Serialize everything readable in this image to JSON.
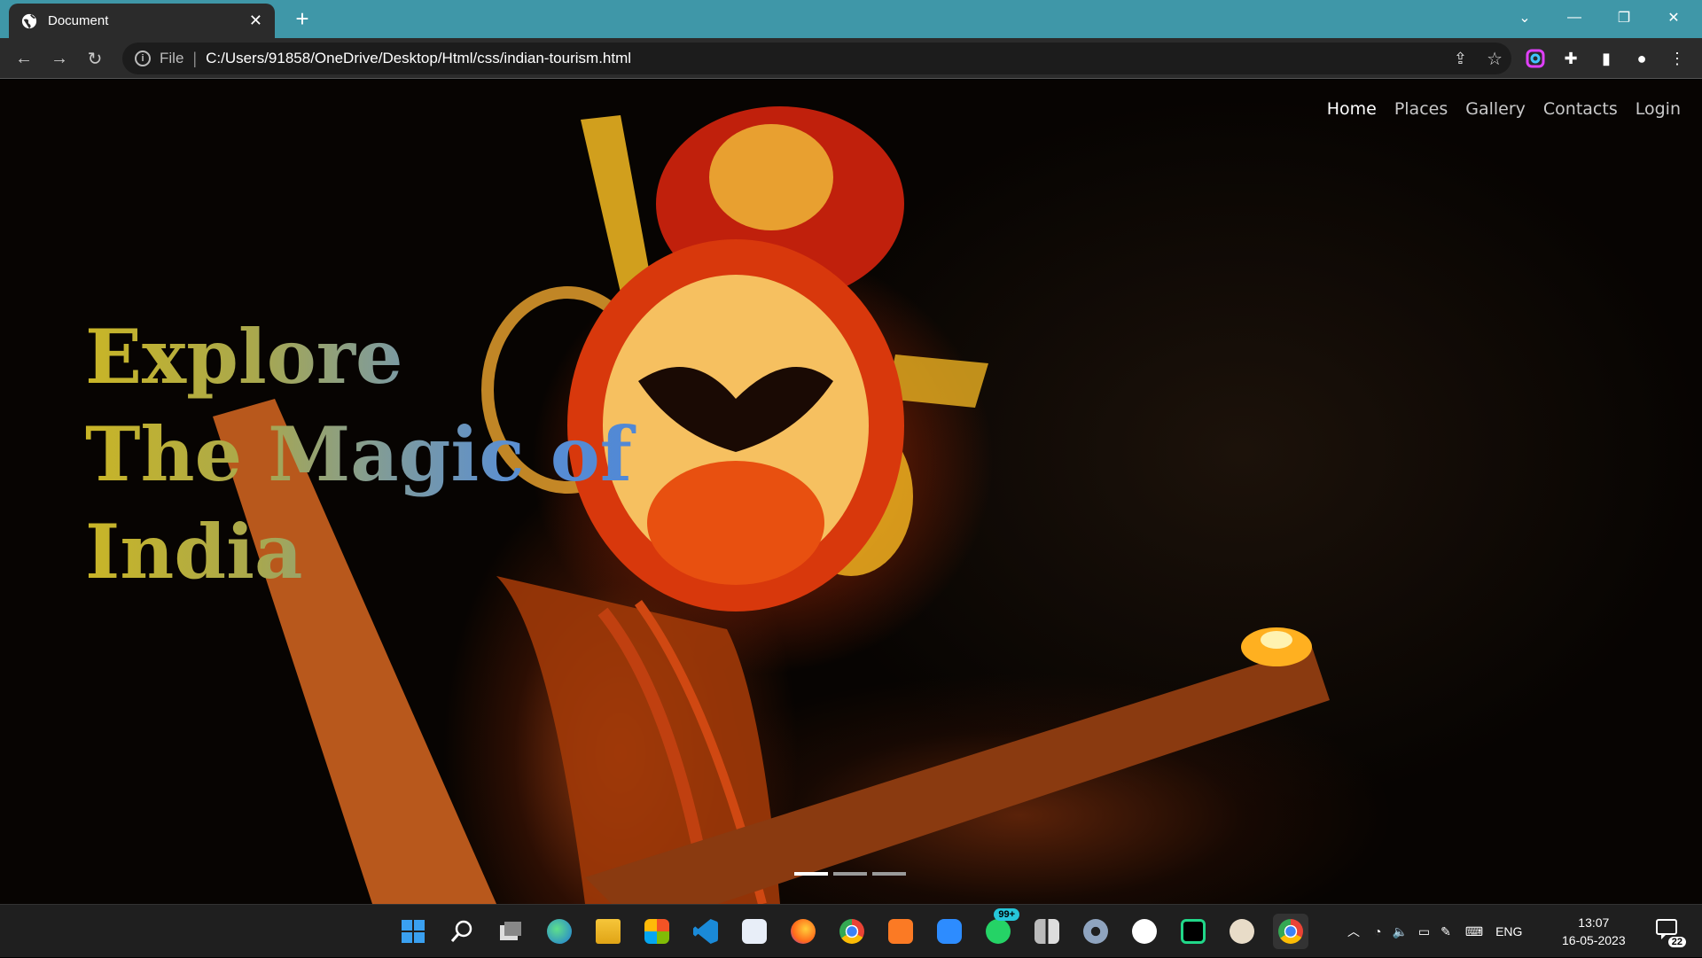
{
  "browser": {
    "tab_title": "Document",
    "new_tab": "+",
    "close_tab": "✕",
    "url_scheme": "File",
    "url": "C:/Users/91858/OneDrive/Desktop/Html/css/indian-tourism.html",
    "controls": {
      "tab_search": "⌄",
      "minimize": "—",
      "restore": "❐",
      "close": "✕"
    }
  },
  "nav": {
    "items": [
      {
        "label": "Home",
        "active": true
      },
      {
        "label": "Places",
        "active": false
      },
      {
        "label": "Gallery",
        "active": false
      },
      {
        "label": "Contacts",
        "active": false
      },
      {
        "label": "Login",
        "active": false
      }
    ]
  },
  "hero": {
    "line1": "Explore",
    "line2": "The Magic of",
    "line3": "India",
    "carousel": {
      "count": 3,
      "active_index": 0
    }
  },
  "taskbar": {
    "apps": [
      "windows-start",
      "search",
      "task-view",
      "edge",
      "file-explorer",
      "microsoft-store",
      "vscode",
      "notepad",
      "firefox",
      "chrome",
      "xampp",
      "zoom",
      "whatsapp",
      "widgets",
      "settings",
      "github",
      "pycharm",
      "avatar-app",
      "chrome-active"
    ],
    "whatsapp_badge": "99+",
    "tray_lang": "ENG",
    "time": "13:07",
    "date": "16-05-2023",
    "notifications": "22"
  }
}
